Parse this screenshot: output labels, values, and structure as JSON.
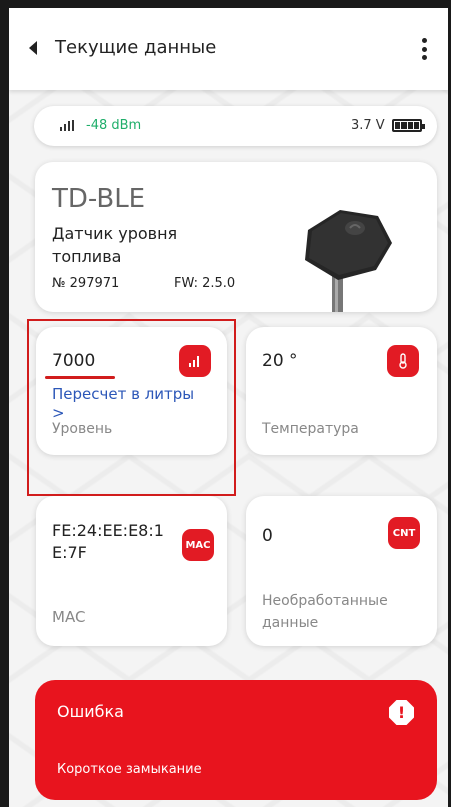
{
  "header": {
    "title": "Текущие данные"
  },
  "status": {
    "signal": "-48 dBm",
    "voltage": "3.7 V"
  },
  "device": {
    "model": "TD-BLE",
    "type": "Датчик уровня топлива",
    "serial": "№ 297971",
    "firmware": "FW: 2.5.0"
  },
  "tiles": {
    "level": {
      "value": "7000",
      "link": "Пересчет в литры",
      "arrow": ">",
      "label": "Уровень"
    },
    "temperature": {
      "value": "20 °",
      "label": "Температура"
    },
    "mac": {
      "value": "FE:24:EE:E8:1E:7F",
      "badge": "MAC",
      "label": "MAC"
    },
    "raw": {
      "value": "0",
      "badge": "CNT",
      "label": "Необработанные данные"
    }
  },
  "error": {
    "title": "Ошибка",
    "description": "Короткое замыкание"
  },
  "colors": {
    "accent": "#e21b24",
    "link": "#2c57b8",
    "signal": "#1fae6a"
  }
}
